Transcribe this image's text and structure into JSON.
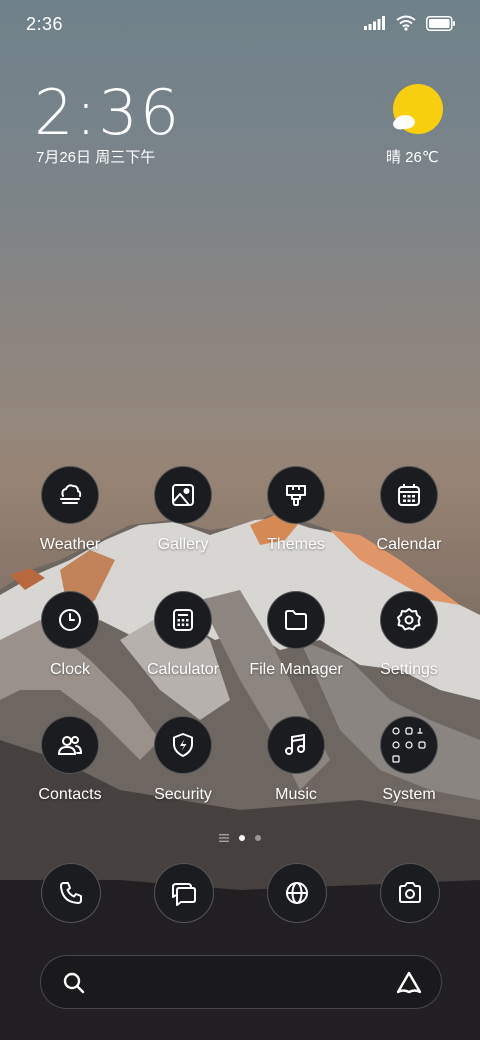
{
  "status_bar": {
    "time": "2:36"
  },
  "clock_widget": {
    "time": "2:36",
    "date": "7月26日 周三下午"
  },
  "weather_widget": {
    "text": "晴 26℃",
    "sun_color": "#f7cf0e"
  },
  "apps": [
    {
      "label": "Weather",
      "icon": "weather-icon"
    },
    {
      "label": "Gallery",
      "icon": "gallery-icon"
    },
    {
      "label": "Themes",
      "icon": "themes-icon"
    },
    {
      "label": "Calendar",
      "icon": "calendar-icon"
    },
    {
      "label": "Clock",
      "icon": "clock-icon"
    },
    {
      "label": "Calculator",
      "icon": "calculator-icon"
    },
    {
      "label": "File Manager",
      "icon": "folder-icon"
    },
    {
      "label": "Settings",
      "icon": "gear-icon"
    },
    {
      "label": "Contacts",
      "icon": "contacts-icon"
    },
    {
      "label": "Security",
      "icon": "shield-icon"
    },
    {
      "label": "Music",
      "icon": "music-icon"
    },
    {
      "label": "System",
      "icon": "folder-grid-icon"
    }
  ],
  "page_indicator": {
    "pages": 2,
    "current": 1
  },
  "dock": [
    "phone-icon",
    "messages-icon",
    "browser-icon",
    "camera-icon"
  ],
  "search_bar": {
    "icon": "search-icon",
    "assistant_icon": "assistant-icon"
  }
}
